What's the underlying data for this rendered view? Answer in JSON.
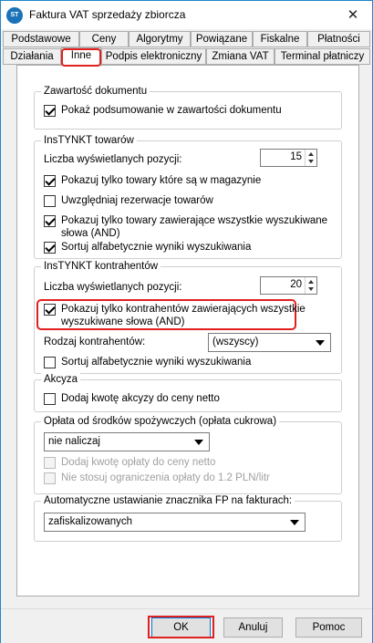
{
  "window": {
    "title": "Faktura VAT sprzedaży zbiorcza",
    "app_icon_text": "ST",
    "close_glyph": "✕"
  },
  "tabs_row1": [
    "Podstawowe",
    "Ceny",
    "Algorytmy",
    "Powiązane",
    "Fiskalne",
    "Płatności"
  ],
  "tabs_row2": [
    "Działania",
    "Inne",
    "Podpis elektroniczny",
    "Zmiana VAT",
    "Terminal płatniczy"
  ],
  "active_tab": "Inne",
  "zawartosc": {
    "legend": "Zawartość dokumentu",
    "summary": {
      "label": "Pokaż podsumowanie w zawartości dokumentu",
      "checked": true
    }
  },
  "towary": {
    "legend": "InsTYNKT towarów",
    "count_label": "Liczba wyświetlanych pozycji:",
    "count_value": "15",
    "only_stock": {
      "label": "Pokazuj tylko towary które są w magazynie",
      "checked": true
    },
    "reservations": {
      "label": "Uwzględniaj rezerwacje towarów",
      "checked": false
    },
    "all_words": {
      "label_line1": "Pokazuj tylko towary zawierające wszystkie wyszukiwane",
      "label_line2": "słowa (AND)",
      "checked": true
    },
    "sort": {
      "label": "Sortuj alfabetycznie wyniki wyszukiwania",
      "checked": true
    }
  },
  "kontrahenci": {
    "legend": "InsTYNKT kontrahentów",
    "count_label": "Liczba wyświetlanych pozycji:",
    "count_value": "20",
    "all_words": {
      "label_line1": "Pokazuj tylko kontrahentów zawierających wszystkie",
      "label_line2": "wyszukiwane słowa (AND)",
      "checked": true
    },
    "type_label": "Rodzaj kontrahentów:",
    "type_value": "(wszyscy)",
    "sort": {
      "label": "Sortuj alfabetycznie wyniki wyszukiwania",
      "checked": false
    }
  },
  "akcyza": {
    "legend": "Akcyza",
    "add": {
      "label": "Dodaj kwotę akcyzy do ceny netto",
      "checked": false
    }
  },
  "oplata": {
    "legend": "Opłata od środków spożywczych (opłata cukrowa)",
    "select_value": "nie naliczaj",
    "add": {
      "label": "Dodaj kwotę opłaty do ceny netto",
      "checked": false
    },
    "no_limit": {
      "label": "Nie stosuj ograniczenia opłaty do 1.2 PLN/litr",
      "checked": false
    }
  },
  "fp": {
    "legend": "Automatyczne ustawianie znacznika FP na fakturach:",
    "select_value": "zafiskalizowanych"
  },
  "buttons": {
    "ok": "OK",
    "cancel": "Anuluj",
    "help": "Pomoc"
  }
}
